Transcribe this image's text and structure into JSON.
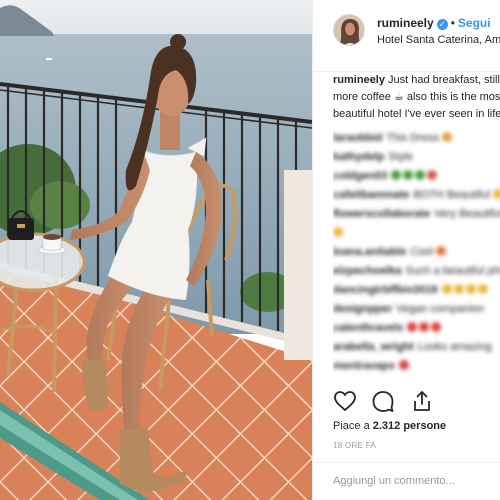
{
  "post": {
    "username": "rumineely",
    "verified_icon": "verified-badge-icon",
    "separator": "•",
    "follow_label": "Segui",
    "location": "Hotel Santa Caterina, Amalfi"
  },
  "caption": {
    "username": "rumineely",
    "lines": [
      "Just had breakfast, still need",
      "more coffee ☕ also this is the most",
      "beautiful hotel I've ever seen in life"
    ]
  },
  "comments": [
    {
      "user": "laraobbid",
      "text": "This Dress"
    },
    {
      "user": "kathydelp",
      "text": "Style"
    },
    {
      "user": "coldgen03",
      "text": ""
    },
    {
      "user": "cafelibammate",
      "text": "BOTH Beautiful"
    },
    {
      "user": "flowerscollaborate",
      "text": "Very Beautiful"
    },
    {
      "user": "",
      "text": ""
    },
    {
      "user": "loana.anitable",
      "text": "Cool"
    },
    {
      "user": "elzpechoelka",
      "text": "Such a beautiful photo"
    },
    {
      "user": "dancingtrbffbiv2018",
      "text": ""
    },
    {
      "user": "designpper",
      "text": "Vegan companion"
    },
    {
      "user": "calenthravels",
      "text": ""
    },
    {
      "user": "arabella_wright",
      "text": "Looks amazing"
    },
    {
      "user": "mentravaps",
      "text": ""
    }
  ],
  "actions": {
    "like_icon": "heart-icon",
    "comment_icon": "comment-icon",
    "share_icon": "share-icon"
  },
  "likes": {
    "prefix": "Piace a ",
    "count": "2.312",
    "suffix": " persone"
  },
  "time_ago": "18 ORE FA",
  "add_comment": {
    "placeholder": "Aggiungi un commento..."
  },
  "colors": {
    "accent": "#3897f0",
    "text": "#262626",
    "muted": "#999999",
    "border": "#efefef"
  }
}
